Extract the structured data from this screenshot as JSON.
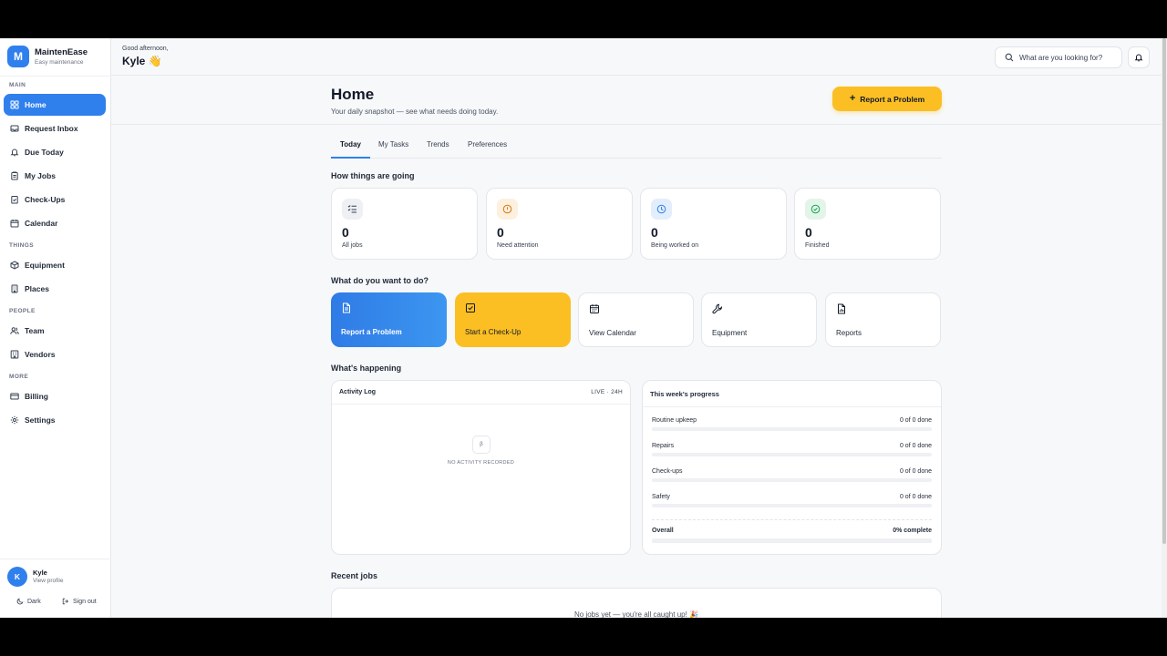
{
  "brand": {
    "logo_letter": "M",
    "name": "MaintenEase",
    "tagline": "Easy maintenance"
  },
  "sidebar": {
    "sections": [
      {
        "label": "MAIN",
        "items": [
          {
            "label": "Home",
            "icon": "grid-icon",
            "active": true
          },
          {
            "label": "Request Inbox",
            "icon": "inbox-icon"
          },
          {
            "label": "Due Today",
            "icon": "bell-icon"
          },
          {
            "label": "My Jobs",
            "icon": "clipboard-icon"
          },
          {
            "label": "Check-Ups",
            "icon": "clipboard-check-icon"
          },
          {
            "label": "Calendar",
            "icon": "calendar-icon"
          }
        ]
      },
      {
        "label": "THINGS",
        "items": [
          {
            "label": "Equipment",
            "icon": "box-icon"
          },
          {
            "label": "Places",
            "icon": "building-icon"
          }
        ]
      },
      {
        "label": "PEOPLE",
        "items": [
          {
            "label": "Team",
            "icon": "users-icon"
          },
          {
            "label": "Vendors",
            "icon": "vendors-icon"
          }
        ]
      },
      {
        "label": "MORE",
        "items": [
          {
            "label": "Billing",
            "icon": "card-icon"
          },
          {
            "label": "Settings",
            "icon": "gear-icon"
          }
        ]
      }
    ],
    "profile": {
      "initial": "K",
      "name": "Kyle",
      "sub": "View profile"
    },
    "theme_label": "Dark",
    "signout_label": "Sign out"
  },
  "header": {
    "greeting": "Good afternoon,",
    "user": "Kyle 👋",
    "search_placeholder": "What are you looking for?"
  },
  "page": {
    "title": "Home",
    "subtitle": "Your daily snapshot — see what needs doing today.",
    "cta": "Report a Problem",
    "cta_plus": "+"
  },
  "tabs": [
    "Today",
    "My Tasks",
    "Trends",
    "Preferences"
  ],
  "stats": {
    "title": "How things are going",
    "cards": [
      {
        "value": "0",
        "label": "All jobs",
        "icon": "list-icon",
        "tint": "#eef0f4",
        "color": "#374151"
      },
      {
        "value": "0",
        "label": "Need attention",
        "icon": "alert-icon",
        "tint": "#fdf0df",
        "color": "#d97706"
      },
      {
        "value": "0",
        "label": "Being worked on",
        "icon": "clock-icon",
        "tint": "#e3eefc",
        "color": "#2f80ed"
      },
      {
        "value": "0",
        "label": "Finished",
        "icon": "check-circle-icon",
        "tint": "#e3f5ea",
        "color": "#16a34a"
      }
    ]
  },
  "actions": {
    "title": "What do you want to do?",
    "cards": [
      {
        "label": "Report a Problem",
        "icon": "document-icon",
        "style": "blue"
      },
      {
        "label": "Start a Check-Up",
        "icon": "checkbox-icon",
        "style": "yellow"
      },
      {
        "label": "View Calendar",
        "icon": "calendar-icon",
        "style": "plain"
      },
      {
        "label": "Equipment",
        "icon": "wrench-icon",
        "style": "plain"
      },
      {
        "label": "Reports",
        "icon": "report-icon",
        "style": "plain"
      }
    ]
  },
  "happening": {
    "title": "What's happening",
    "activity": {
      "title": "Activity Log",
      "live": "LIVE · 24H",
      "empty_glyph": "β",
      "empty": "NO ACTIVITY RECORDED"
    },
    "progress": {
      "title": "This week's progress",
      "rows": [
        {
          "label": "Routine upkeep",
          "value": "0 of 0 done",
          "fraction": 0
        },
        {
          "label": "Repairs",
          "value": "0 of 0 done",
          "fraction": 0
        },
        {
          "label": "Check-ups",
          "value": "0 of 0 done",
          "fraction": 0
        },
        {
          "label": "Safety",
          "value": "0 of 0 done",
          "fraction": 0
        }
      ],
      "overall": {
        "label": "Overall",
        "value": "0% complete",
        "fraction": 0
      }
    }
  },
  "recent": {
    "title": "Recent jobs",
    "empty": "No jobs yet — you're all caught up! 🎉"
  },
  "colors": {
    "accent": "#2f80ed",
    "cta": "#fbbf24"
  }
}
